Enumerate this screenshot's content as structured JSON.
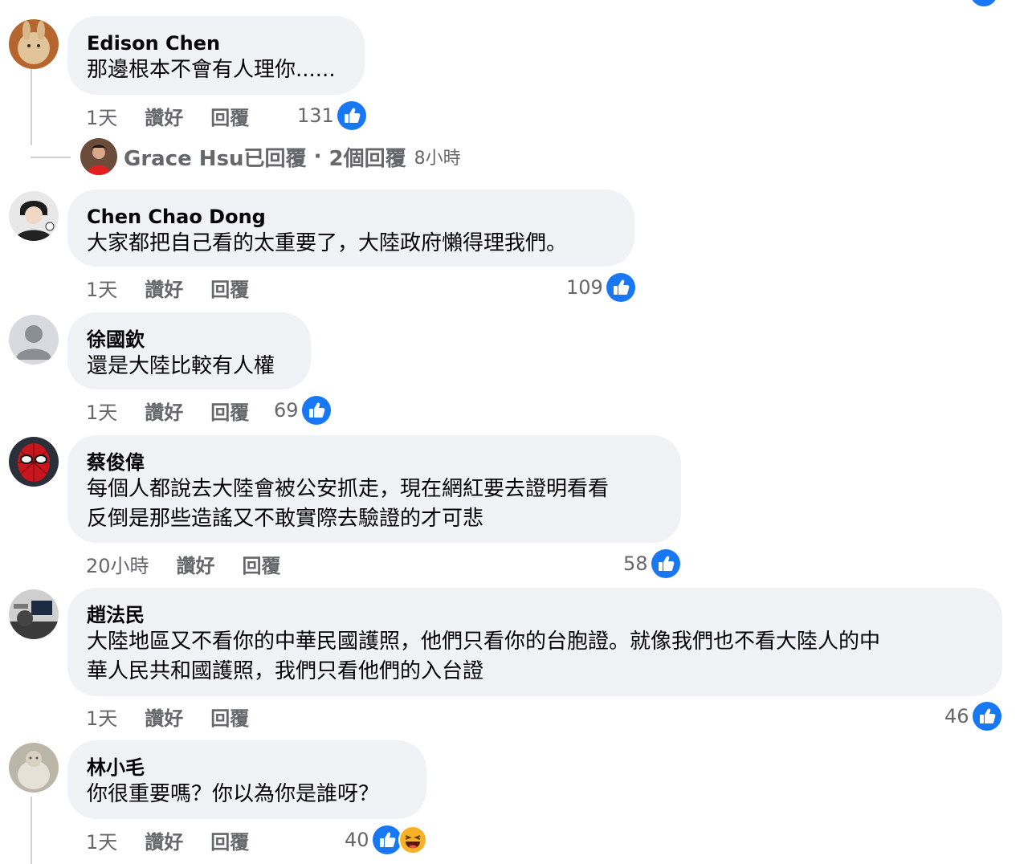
{
  "colors": {
    "bubble": "#f0f2f5",
    "secondary_text": "#65676b",
    "like_blue": "#1877f2",
    "haha_yellow": "#f7b125"
  },
  "action_labels": {
    "like": "讚好",
    "reply": "回覆"
  },
  "comments": [
    {
      "author": "Edison Chen",
      "text": "那邊根本不會有人理你......",
      "time": "1天",
      "reaction_count": "131",
      "reactions": [
        "like-icon"
      ],
      "replies_summary": {
        "name_text": "Grace Hsu已回覆",
        "sep": " · ",
        "count_text": "2個回覆",
        "time": "8小時"
      }
    },
    {
      "author": "Chen Chao Dong",
      "text": "大家都把自己看的太重要了，大陸政府懶得理我們。",
      "time": "1天",
      "reaction_count": "109",
      "reactions": [
        "like-icon"
      ]
    },
    {
      "author": "徐國欽",
      "text": "還是大陸比較有人權",
      "time": "1天",
      "reaction_count": "69",
      "reactions": [
        "like-icon"
      ]
    },
    {
      "author": "蔡俊偉",
      "text": "每個人都說去大陸會被公安抓走，現在網紅要去證明看看\n反倒是那些造謠又不敢實際去驗證的才可悲",
      "time": "20小時",
      "reaction_count": "58",
      "reactions": [
        "like-icon"
      ]
    },
    {
      "author": "趙法民",
      "text": "大陸地區又不看你的中華民國護照，他們只看你的台胞證。就像我們也不看大陸人的中\n華人民共和國護照，我們只看他們的入台證",
      "time": "1天",
      "reaction_count": "46",
      "reactions": [
        "like-icon"
      ]
    },
    {
      "author": "林小毛",
      "text": "你很重要嗎？你以為你是誰呀？",
      "time": "1天",
      "reaction_count": "40",
      "reactions": [
        "like-icon",
        "haha-icon"
      ]
    }
  ]
}
